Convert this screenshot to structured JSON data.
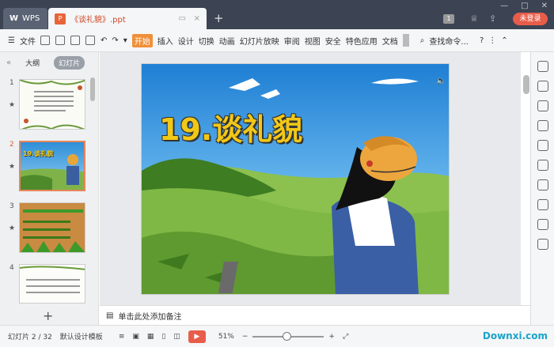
{
  "titlebar": {
    "app_tab": "WPS",
    "doc_tab": "《谈礼貌》.ppt",
    "new_tab": "+",
    "login": "未登录",
    "badge": "1"
  },
  "menubar": {
    "file": "文件",
    "tabs": [
      "开始",
      "插入",
      "设计",
      "切换",
      "动画",
      "幻灯片放映",
      "审阅",
      "视图",
      "安全",
      "特色应用",
      "文档"
    ],
    "active_tab": "开始",
    "search": "查找命令..."
  },
  "left_panel": {
    "tab_outline": "大纲",
    "tab_slides": "幻灯片",
    "slides": [
      {
        "num": "1",
        "star": "★"
      },
      {
        "num": "2",
        "star": "★"
      },
      {
        "num": "3",
        "star": "★"
      },
      {
        "num": "4",
        "star": ""
      }
    ],
    "slide2_title": "19.谈礼貌",
    "add_slide": "+"
  },
  "slide": {
    "title": "19.谈礼貌"
  },
  "notes": {
    "placeholder": "单击此处添加备注"
  },
  "status": {
    "slide_counter": "幻灯片 2 / 32",
    "template": "默认设计模板",
    "zoom": "51%",
    "minus": "−",
    "plus": "+",
    "watermark": "Downxi.com"
  }
}
